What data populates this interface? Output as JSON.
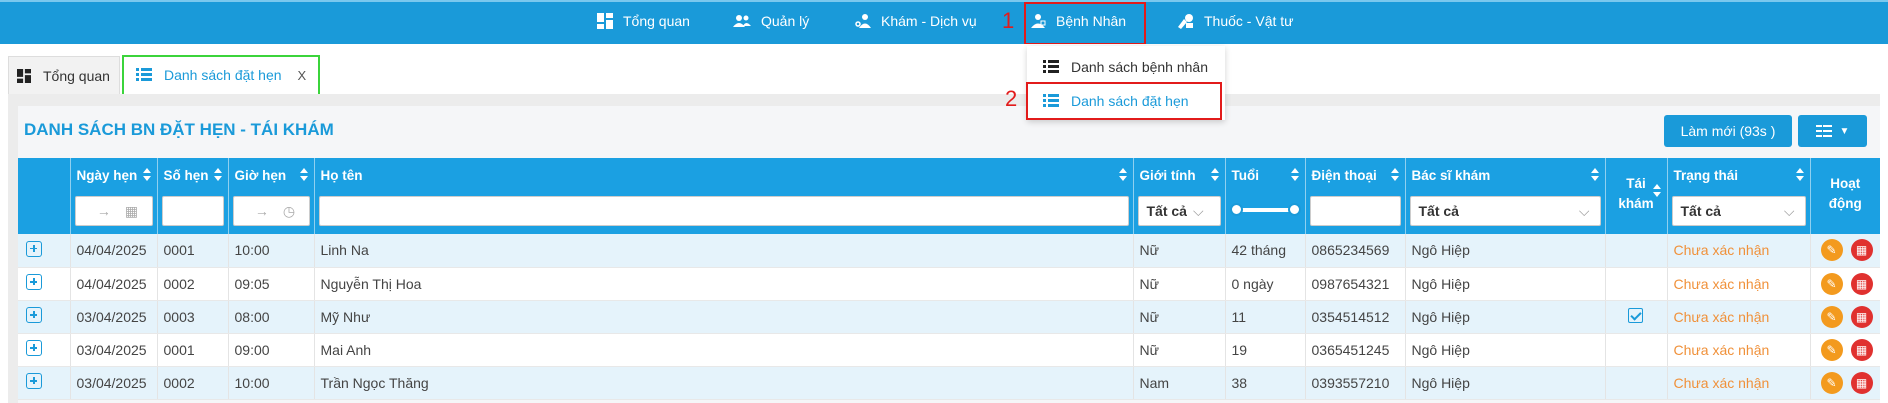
{
  "topnav": {
    "items": [
      {
        "label": "Tổng quan",
        "icon": "dashboard-icon"
      },
      {
        "label": "Quản lý",
        "icon": "users-icon"
      },
      {
        "label": "Khám - Dịch vụ",
        "icon": "doctor-icon"
      },
      {
        "label": "Bệnh Nhân",
        "icon": "patient-icon"
      },
      {
        "label": "Thuốc - Vật tư",
        "icon": "medicine-icon"
      }
    ]
  },
  "annotations": {
    "step1": "1",
    "step2": "2"
  },
  "dropdown": {
    "items": [
      {
        "label": "Danh sách bệnh nhân"
      },
      {
        "label": "Danh sách đặt hẹn"
      }
    ]
  },
  "tabs": [
    {
      "label": "Tổng quan"
    },
    {
      "label": "Danh sách đặt hẹn",
      "close": "X"
    }
  ],
  "page": {
    "title": "DANH SÁCH BN ĐẶT HẸN - TÁI KHÁM",
    "refresh_label": "Làm mới (93s )"
  },
  "table": {
    "headers": {
      "date": "Ngày hẹn",
      "number": "Số hẹn",
      "time": "Giờ hẹn",
      "name": "Họ tên",
      "gender": "Giới tính",
      "age": "Tuổi",
      "phone": "Điện thoại",
      "doctor": "Bác sĩ khám",
      "revisit_1": "Tái",
      "revisit_2": "khám",
      "status": "Trạng thái",
      "action_1": "Hoạt",
      "action_2": "động"
    },
    "filters": {
      "gender": "Tất cả",
      "doctor": "Tất cả",
      "status": "Tất cả",
      "range_arrow": "→"
    },
    "rows": [
      {
        "date": "04/04/2025",
        "number": "0001",
        "time": "10:00",
        "name": "Linh Na",
        "gender": "Nữ",
        "age": "42 tháng",
        "phone": "0865234569",
        "doctor": "Ngô Hiệp",
        "revisit": false,
        "status": "Chưa xác nhận"
      },
      {
        "date": "04/04/2025",
        "number": "0002",
        "time": "09:05",
        "name": "Nguyễn Thị Hoa",
        "gender": "Nữ",
        "age": "0 ngày",
        "phone": "0987654321",
        "doctor": "Ngô Hiệp",
        "revisit": false,
        "status": "Chưa xác nhận"
      },
      {
        "date": "03/04/2025",
        "number": "0003",
        "time": "08:00",
        "name": "Mỹ Như",
        "gender": "Nữ",
        "age": "11",
        "phone": "0354514512",
        "doctor": "Ngô Hiệp",
        "revisit": true,
        "status": "Chưa xác nhận"
      },
      {
        "date": "03/04/2025",
        "number": "0001",
        "time": "09:00",
        "name": "Mai Anh",
        "gender": "Nữ",
        "age": "19",
        "phone": "0365451245",
        "doctor": "Ngô Hiệp",
        "revisit": false,
        "status": "Chưa xác nhận"
      },
      {
        "date": "03/04/2025",
        "number": "0002",
        "time": "10:00",
        "name": "Trần Ngọc Thăng",
        "gender": "Nam",
        "age": "38",
        "phone": "0393557210",
        "doctor": "Ngô Hiệp",
        "revisit": false,
        "status": "Chưa xác nhận"
      }
    ]
  },
  "colors": {
    "primary": "#1a9ad9",
    "annotation_red": "#e21b1b",
    "annotation_green": "#3bd43b",
    "status_pending": "#f0913a"
  }
}
